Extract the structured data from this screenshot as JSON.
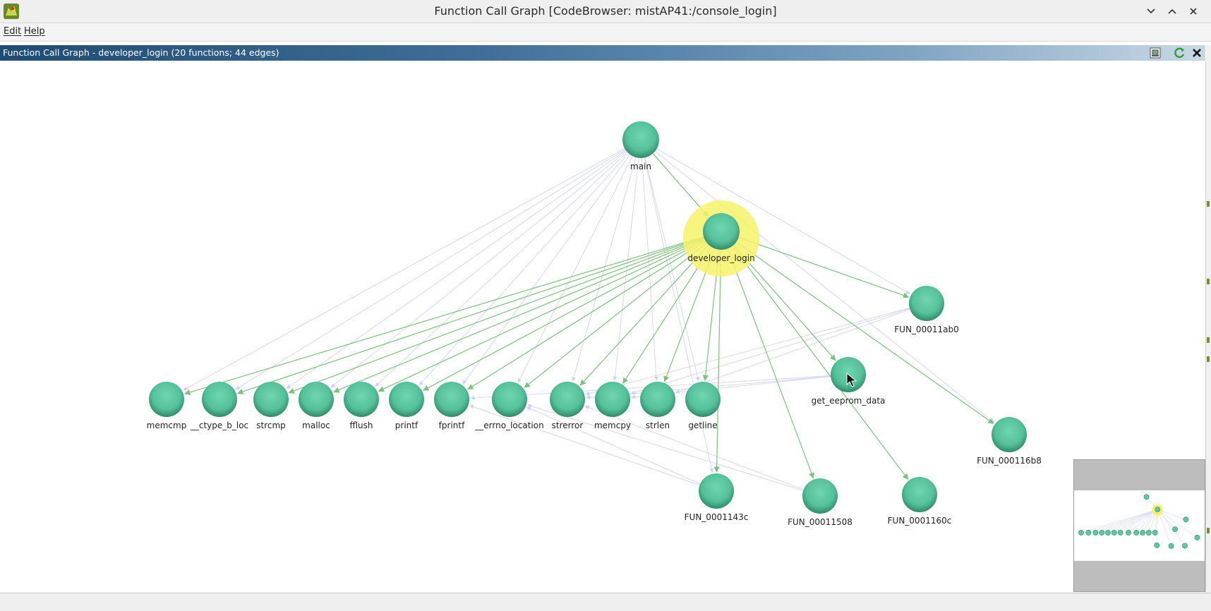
{
  "window": {
    "title": "Function Call Graph [CodeBrowser: mistAP41:/console_login]",
    "controls": [
      "chevron-down-icon",
      "chevron-up-icon",
      "close-icon"
    ]
  },
  "menu": {
    "items": [
      "Edit",
      "Help"
    ]
  },
  "panel": {
    "title": "Function Call Graph - developer_login (20 functions; 44 edges)",
    "buttons": [
      "snapshot-icon",
      "refresh-icon",
      "close-icon"
    ]
  },
  "graph": {
    "focus": "developer_login",
    "colors": {
      "node": "#5cc8a2",
      "node_dark": "#2f8a6a",
      "highlight": "#f7f26a",
      "call_edge": "#7fbf7f",
      "faint_edge": "#d6d6f0"
    },
    "nodes": [
      {
        "id": "main",
        "label": "main"
      },
      {
        "id": "developer_login",
        "label": "developer_login",
        "highlighted": true
      },
      {
        "id": "FUN_00011ab0",
        "label": "FUN_00011ab0"
      },
      {
        "id": "get_eeprom_data",
        "label": "get_eeprom_data"
      },
      {
        "id": "FUN_000116b8",
        "label": "FUN_000116b8"
      },
      {
        "id": "memcmp",
        "label": "memcmp"
      },
      {
        "id": "__ctype_b_loc",
        "label": "__ctype_b_loc"
      },
      {
        "id": "strcmp",
        "label": "strcmp"
      },
      {
        "id": "malloc",
        "label": "malloc"
      },
      {
        "id": "fflush",
        "label": "fflush"
      },
      {
        "id": "printf",
        "label": "printf"
      },
      {
        "id": "fprintf",
        "label": "fprintf"
      },
      {
        "id": "__errno_location",
        "label": "__errno_location"
      },
      {
        "id": "strerror",
        "label": "strerror"
      },
      {
        "id": "memcpy",
        "label": "memcpy"
      },
      {
        "id": "strlen",
        "label": "strlen"
      },
      {
        "id": "getline",
        "label": "getline"
      },
      {
        "id": "FUN_0001143c",
        "label": "FUN_0001143c"
      },
      {
        "id": "FUN_00011508",
        "label": "FUN_00011508"
      },
      {
        "id": "FUN_0001160c",
        "label": "FUN_0001160c"
      }
    ],
    "call_edges": [
      [
        "main",
        "developer_login"
      ],
      [
        "developer_login",
        "FUN_00011ab0"
      ],
      [
        "developer_login",
        "get_eeprom_data"
      ],
      [
        "developer_login",
        "FUN_000116b8"
      ],
      [
        "developer_login",
        "memcmp"
      ],
      [
        "developer_login",
        "__ctype_b_loc"
      ],
      [
        "developer_login",
        "strcmp"
      ],
      [
        "developer_login",
        "malloc"
      ],
      [
        "developer_login",
        "fflush"
      ],
      [
        "developer_login",
        "printf"
      ],
      [
        "developer_login",
        "fprintf"
      ],
      [
        "developer_login",
        "__errno_location"
      ],
      [
        "developer_login",
        "strerror"
      ],
      [
        "developer_login",
        "memcpy"
      ],
      [
        "developer_login",
        "strlen"
      ],
      [
        "developer_login",
        "getline"
      ],
      [
        "developer_login",
        "FUN_0001143c"
      ],
      [
        "developer_login",
        "FUN_00011508"
      ],
      [
        "developer_login",
        "FUN_0001160c"
      ]
    ],
    "faint_edges": [
      [
        "main",
        "memcmp"
      ],
      [
        "main",
        "__ctype_b_loc"
      ],
      [
        "main",
        "strcmp"
      ],
      [
        "main",
        "malloc"
      ],
      [
        "main",
        "fflush"
      ],
      [
        "main",
        "printf"
      ],
      [
        "main",
        "fprintf"
      ],
      [
        "main",
        "__errno_location"
      ],
      [
        "main",
        "strerror"
      ],
      [
        "main",
        "memcpy"
      ],
      [
        "main",
        "strlen"
      ],
      [
        "main",
        "getline"
      ],
      [
        "main",
        "FUN_00011ab0"
      ],
      [
        "main",
        "FUN_000116b8"
      ],
      [
        "main",
        "FUN_0001143c"
      ],
      [
        "FUN_00011ab0",
        "memcpy"
      ],
      [
        "FUN_00011ab0",
        "strerror"
      ],
      [
        "FUN_00011ab0",
        "strlen"
      ],
      [
        "get_eeprom_data",
        "strerror"
      ],
      [
        "get_eeprom_data",
        "memcpy"
      ],
      [
        "get_eeprom_data",
        "fprintf"
      ],
      [
        "FUN_0001143c",
        "__errno_location"
      ],
      [
        "FUN_0001143c",
        "fprintf"
      ],
      [
        "FUN_00011508",
        "__errno_location"
      ],
      [
        "FUN_00011508",
        "strerror"
      ]
    ]
  }
}
